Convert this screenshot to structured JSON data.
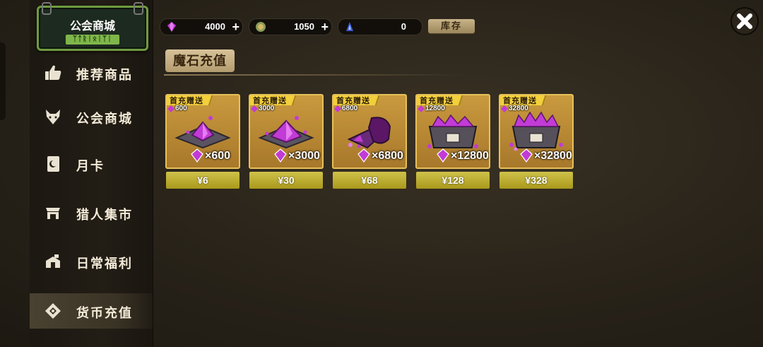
{
  "header": {
    "guild_title": "公会商城",
    "guild_sub": "ᛉᛏᚱᛁᛟᛁᛉᛁ"
  },
  "sidebar": {
    "items": [
      {
        "label": "推荐商品",
        "icon": "thumbs-up-icon"
      },
      {
        "label": "公会商城",
        "icon": "wolf-head-icon"
      },
      {
        "label": "月卡",
        "icon": "moon-card-icon"
      },
      {
        "label": "猎人集市",
        "icon": "market-stall-icon"
      },
      {
        "label": "日常福利",
        "icon": "gift-box-icon"
      },
      {
        "label": "货币充值",
        "icon": "diamond-coin-icon"
      }
    ],
    "active_index": 5
  },
  "currencies": [
    {
      "name": "magic-stone",
      "icon": "purple-gem-icon",
      "value": "4000",
      "plus": "+"
    },
    {
      "name": "coin",
      "icon": "green-coin-icon",
      "value": "1050",
      "plus": "+"
    },
    {
      "name": "crystal",
      "icon": "blue-crystal-icon",
      "value": "0"
    }
  ],
  "store_button": "库存",
  "section_title": "魔石充值",
  "products": [
    {
      "ribbon": "首充赠送",
      "bonus": "600",
      "quantity": "×600",
      "price": "¥6"
    },
    {
      "ribbon": "首充赠送",
      "bonus": "3000",
      "quantity": "×3000",
      "price": "¥30"
    },
    {
      "ribbon": "首充赠送",
      "bonus": "6800",
      "quantity": "×6800",
      "price": "¥68"
    },
    {
      "ribbon": "首充赠送",
      "bonus": "12800",
      "quantity": "×12800",
      "price": "¥128"
    },
    {
      "ribbon": "首充赠送",
      "bonus": "32800",
      "quantity": "×32800",
      "price": "¥328"
    }
  ],
  "colors": {
    "accent_gold": "#e7c159",
    "price_green": "#cfc24a",
    "gem_purple": "#c23bd6",
    "guild_green": "#6f9b3f"
  }
}
